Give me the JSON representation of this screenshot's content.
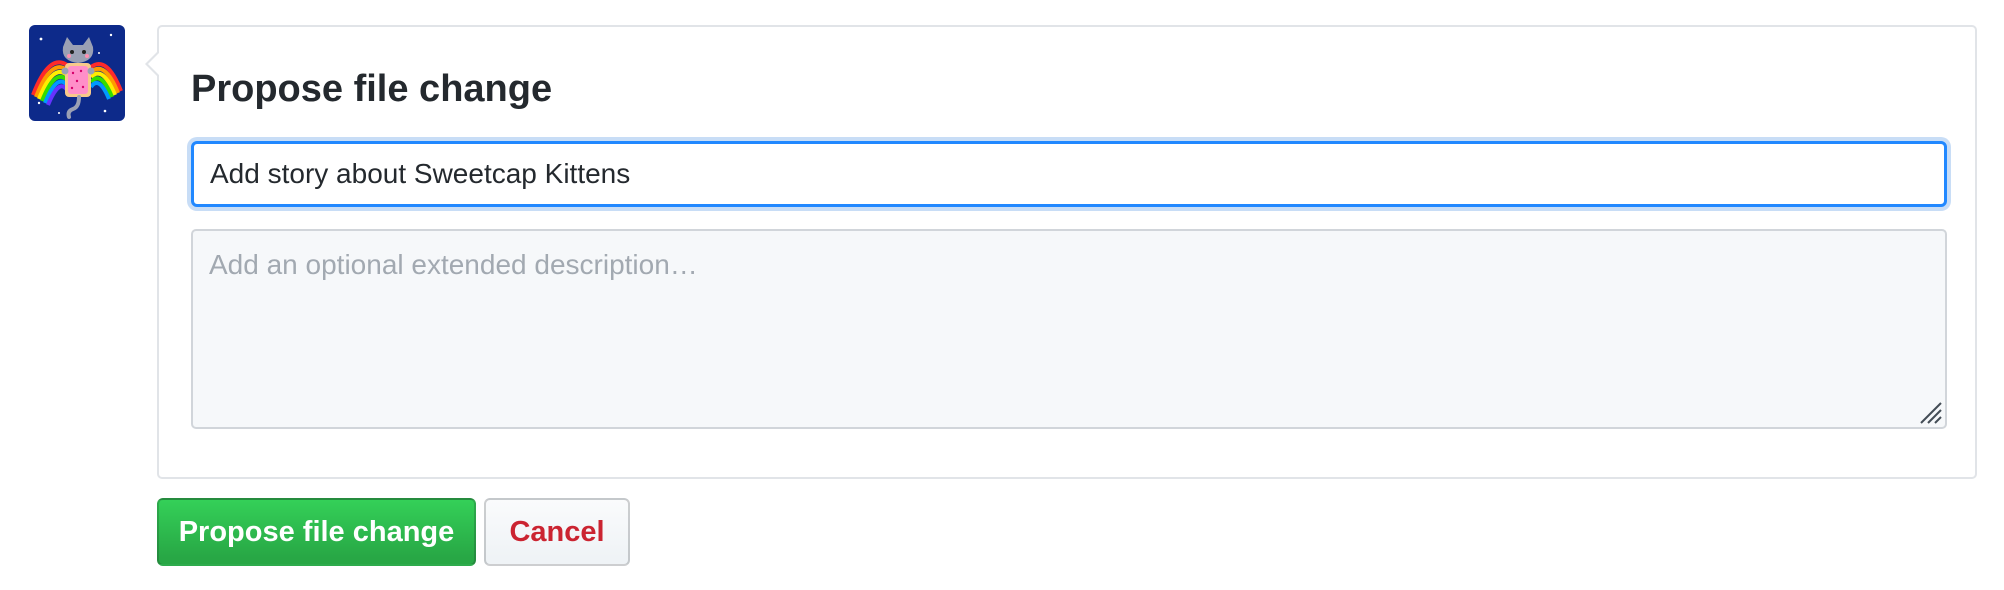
{
  "form": {
    "heading": "Propose file change",
    "summary_value": "Add story about Sweetcap Kittens",
    "description_placeholder": "Add an optional extended description…",
    "description_value": ""
  },
  "actions": {
    "submit_label": "Propose file change",
    "cancel_label": "Cancel"
  },
  "avatar": {
    "icon": "user-avatar-nyan-cat"
  },
  "colors": {
    "focus_border": "#2188ff",
    "primary_button": "#28a745",
    "cancel_text": "#cb2431",
    "textarea_bg": "#f6f8fa"
  }
}
